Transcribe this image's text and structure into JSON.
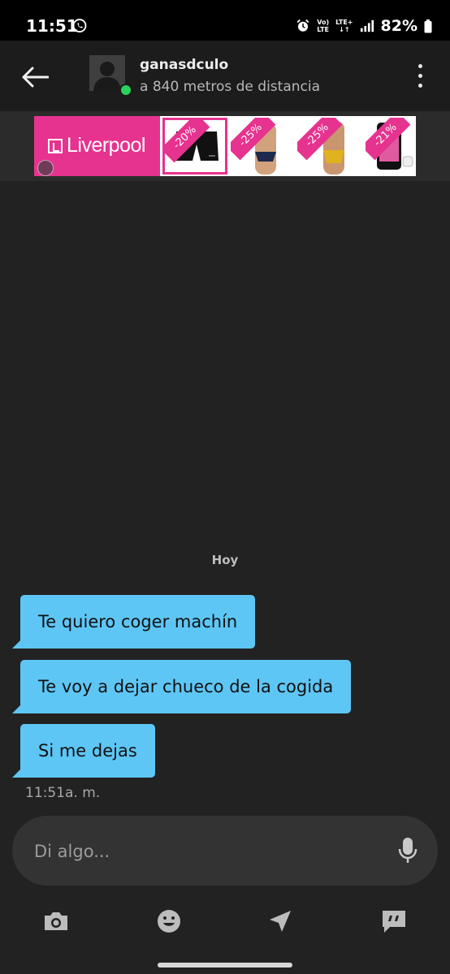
{
  "status_bar": {
    "time": "11:51",
    "network_top": "Vo)",
    "network_bottom": "LTE",
    "lte_top": "LTE+",
    "lte_bottom": "↓↑",
    "battery": "82%"
  },
  "header": {
    "username": "ganasdculo",
    "distance": "a 840 metros de distancia",
    "online": true
  },
  "ad": {
    "brand": "Liverpool",
    "brand_color": "#e6338f",
    "discounts": [
      "-20%",
      "-25%",
      "-25%",
      "-21%"
    ]
  },
  "chat": {
    "day_label": "Hoy",
    "messages": [
      {
        "text": "Te quiero coger machín"
      },
      {
        "text": "Te voy a dejar chueco de la cogida"
      },
      {
        "text": "Si me dejas"
      }
    ],
    "time": "11:51a. m."
  },
  "composer": {
    "placeholder": "Di algo..."
  },
  "toolbar": {
    "icons": [
      "camera-icon",
      "emoji-icon",
      "location-icon",
      "quick-reply-icon"
    ]
  },
  "colors": {
    "bubble": "#5ec6f5",
    "background": "#222222",
    "online": "#2ad35a"
  }
}
